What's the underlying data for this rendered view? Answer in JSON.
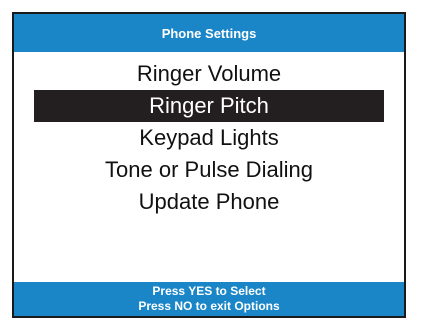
{
  "header": {
    "title": "Phone Settings"
  },
  "menu": {
    "items": [
      {
        "label": "Ringer Volume",
        "selected": false
      },
      {
        "label": "Ringer Pitch",
        "selected": true
      },
      {
        "label": "Keypad Lights",
        "selected": false
      },
      {
        "label": "Tone or Pulse Dialing",
        "selected": false
      },
      {
        "label": "Update Phone",
        "selected": false
      }
    ]
  },
  "footer": {
    "line1": "Press YES to Select",
    "line2": "Press NO to exit Options"
  },
  "colors": {
    "title_bar": "#1a86c8",
    "selection": "#231f20",
    "border": "#1a1a1a"
  }
}
